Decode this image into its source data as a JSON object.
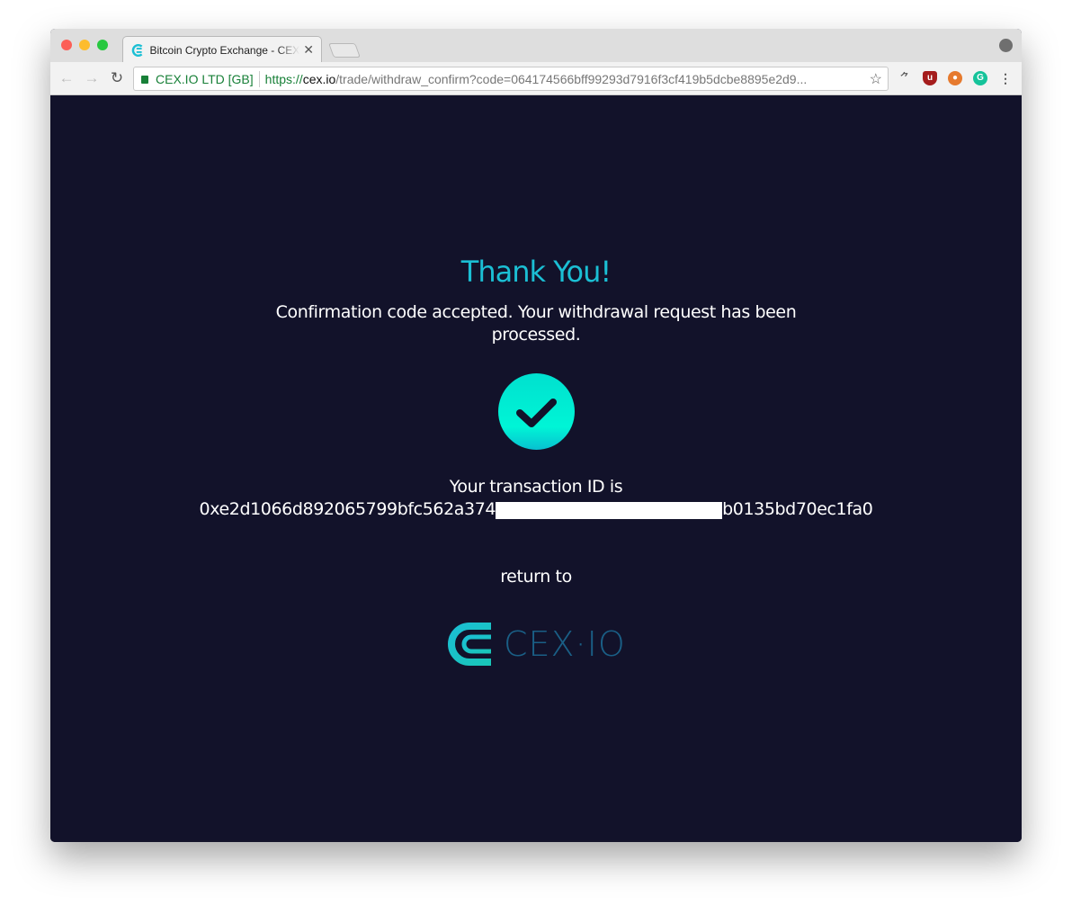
{
  "browser": {
    "tab_title": "Bitcoin Crypto Exchange - CEX.IO",
    "ev_label": "CEX.IO LTD [GB]",
    "url_scheme": "https://",
    "url_host": "cex.io",
    "url_path": "/trade/withdraw_confirm?code=064174566bff99293d7916f3cf419b5dcbe8895e2d9...",
    "extensions": [
      "miner-blocker-icon",
      "ublock-icon",
      "privacy-badger-icon",
      "grammarly-icon"
    ]
  },
  "page": {
    "title": "Thank You!",
    "message": "Confirmation code accepted. Your withdrawal request has been processed.",
    "tx_label": "Your transaction ID is",
    "tx_prefix": "0xe2d1066d892065799bfc562a374",
    "tx_suffix": "b0135bd70ec1fa0",
    "return_label": "return to",
    "logo_text": "CEX·IO"
  },
  "colors": {
    "background": "#12122a",
    "accent": "#1bbfd4",
    "check": "#00f0d6"
  }
}
